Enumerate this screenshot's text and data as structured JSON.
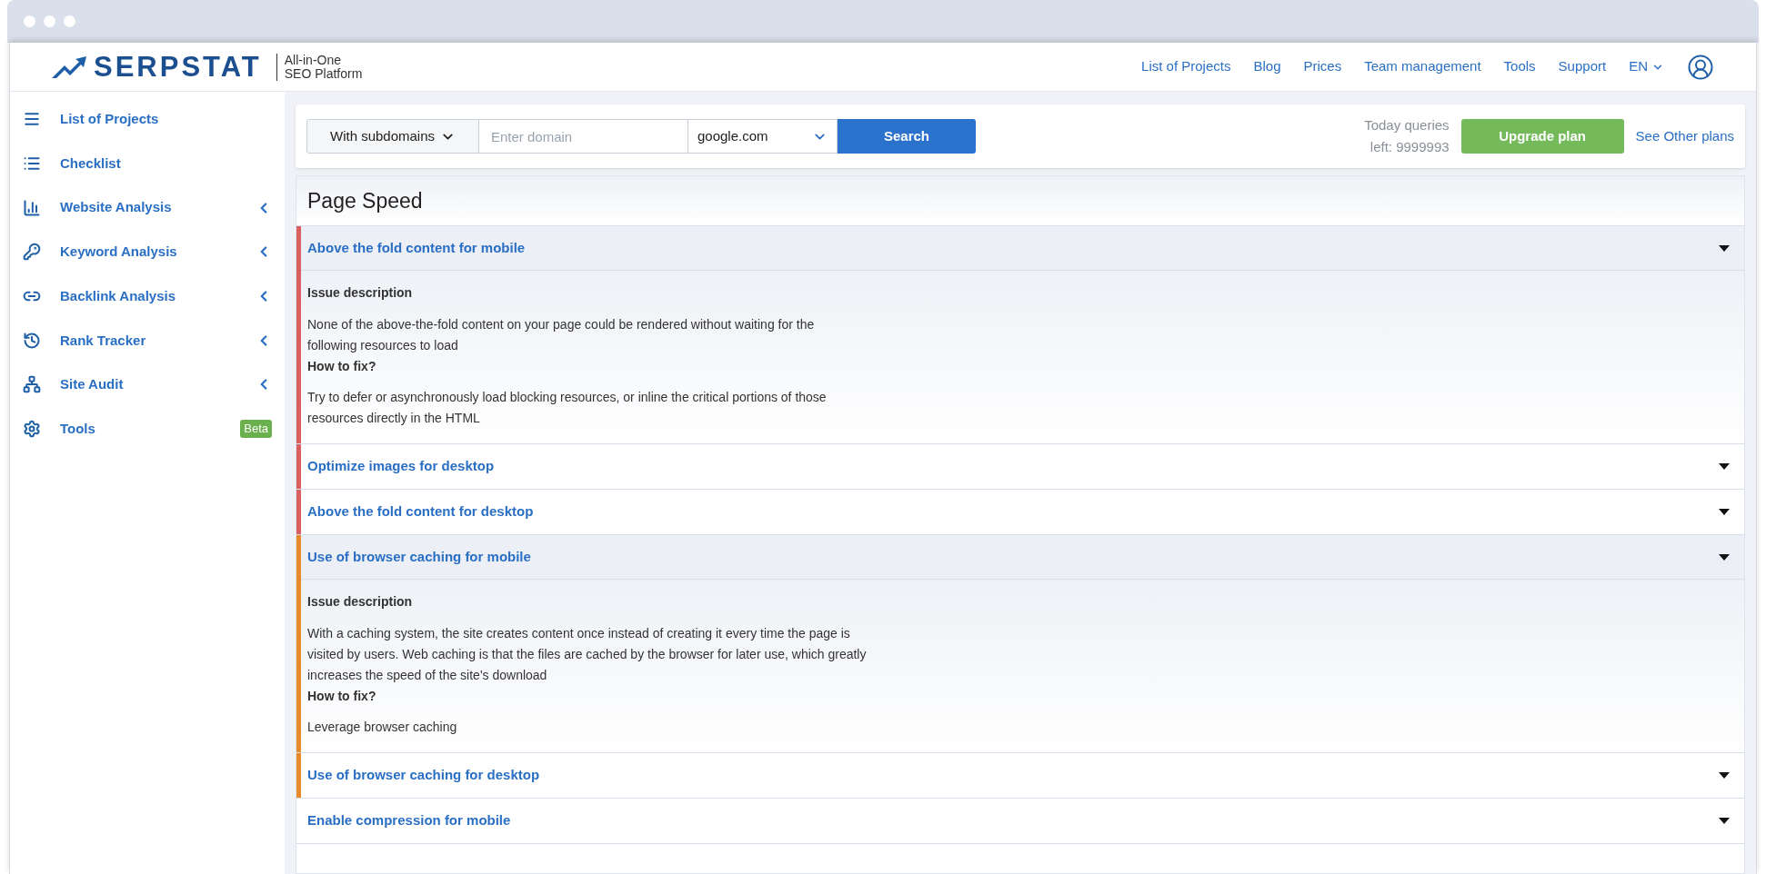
{
  "header": {
    "logo": "SERPSTAT",
    "tagline": [
      "All-in-One",
      "SEO Platform"
    ],
    "nav": [
      "List of Projects",
      "Blog",
      "Prices",
      "Team management",
      "Tools",
      "Support"
    ],
    "language": "EN"
  },
  "sidebar": {
    "items": [
      {
        "label": "List of Projects",
        "submenu": false
      },
      {
        "label": "Checklist",
        "submenu": false
      },
      {
        "label": "Website Analysis",
        "submenu": true
      },
      {
        "label": "Keyword Analysis",
        "submenu": true
      },
      {
        "label": "Backlink Analysis",
        "submenu": true
      },
      {
        "label": "Rank Tracker",
        "submenu": true
      },
      {
        "label": "Site Audit",
        "submenu": true
      },
      {
        "label": "Tools",
        "submenu": false,
        "badge": "Beta"
      }
    ]
  },
  "search": {
    "scope": "With subdomains",
    "placeholder": "Enter domain",
    "engine": "google.com",
    "button": "Search",
    "queries": [
      "Today queries",
      "left: 9999993"
    ],
    "upgrade": "Upgrade plan",
    "other_plans": "See Other plans"
  },
  "page": {
    "title": "Page Speed",
    "issues": [
      {
        "title": "Above the fold content for mobile",
        "color": "#d9605e",
        "expanded": true,
        "description_label": "Issue description",
        "description": "None of the above-the-fold content on your page could be rendered without waiting for the following resources to load",
        "fix_label": "How to fix?",
        "fix": "Try to defer or asynchronously load blocking resources, or inline the critical portions of those resources directly in the HTML"
      },
      {
        "title": "Optimize images for desktop",
        "color": "#d9605e",
        "expanded": false
      },
      {
        "title": "Above the fold content for desktop",
        "color": "#d9605e",
        "expanded": false
      },
      {
        "title": "Use of browser caching for mobile",
        "color": "#e8892a",
        "expanded": true,
        "description_label": "Issue description",
        "description": "With a caching system, the site creates content once instead of creating it every time the page is visited by users. Web caching is that the files are cached by the browser for later use, which greatly increases the speed of the site's download",
        "fix_label": "How to fix?",
        "fix": "Leverage browser caching"
      },
      {
        "title": "Use of browser caching for desktop",
        "color": "#e8892a",
        "expanded": false
      },
      {
        "title": "Enable compression for mobile",
        "expanded": false
      }
    ]
  }
}
